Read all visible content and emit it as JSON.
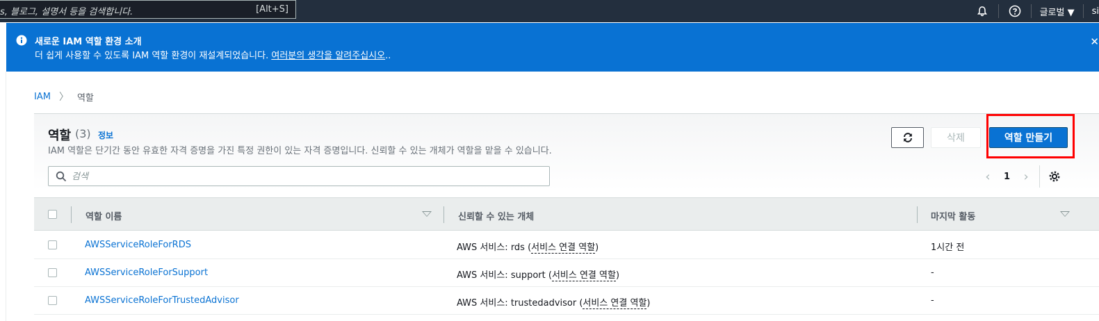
{
  "topbar": {
    "search_text": "s, 블로그, 설명서 등을 검색합니다.",
    "search_shortcut": "[Alt+S]",
    "region_label": "글로벌 ▼",
    "user_fragment": "si"
  },
  "banner": {
    "title": "새로운 IAM 역할 환경 소개",
    "desc_text": "더 쉽게 사용할 수 있도록 IAM 역할 환경이 재설계되었습니다. ",
    "desc_link": "여러분의 생각을 알려주십시오",
    "desc_suffix": ".."
  },
  "breadcrumb": {
    "root": "IAM",
    "current": "역할"
  },
  "panel": {
    "title": "역할",
    "count": "(3)",
    "info": "정보",
    "description": "IAM 역할은 단기간 동안 유효한 자격 증명을 가진 특정 권한이 있는 자격 증명입니다. 신뢰할 수 있는 개체가 역할을 맡을 수 있습니다.",
    "delete_label": "삭제",
    "create_label": "역할 만들기",
    "search_placeholder": "검색",
    "page_number": "1"
  },
  "table": {
    "columns": [
      "역할 이름",
      "신뢰할 수 있는 개체",
      "마지막 활동"
    ],
    "rows": [
      {
        "name": "AWSServiceRoleForRDS",
        "trusted_prefix": "AWS 서비스: rds (",
        "trusted_link": "서비스 연결 역할",
        "trusted_suffix": ")",
        "last": "1시간 전"
      },
      {
        "name": "AWSServiceRoleForSupport",
        "trusted_prefix": "AWS 서비스: support (",
        "trusted_link": "서비스 연결 역할",
        "trusted_suffix": ")",
        "last": "-"
      },
      {
        "name": "AWSServiceRoleForTrustedAdvisor",
        "trusted_prefix": "AWS 서비스: trustedadvisor (",
        "trusted_link": "서비스 연결 역할",
        "trusted_suffix": ")",
        "last": "-"
      }
    ]
  }
}
